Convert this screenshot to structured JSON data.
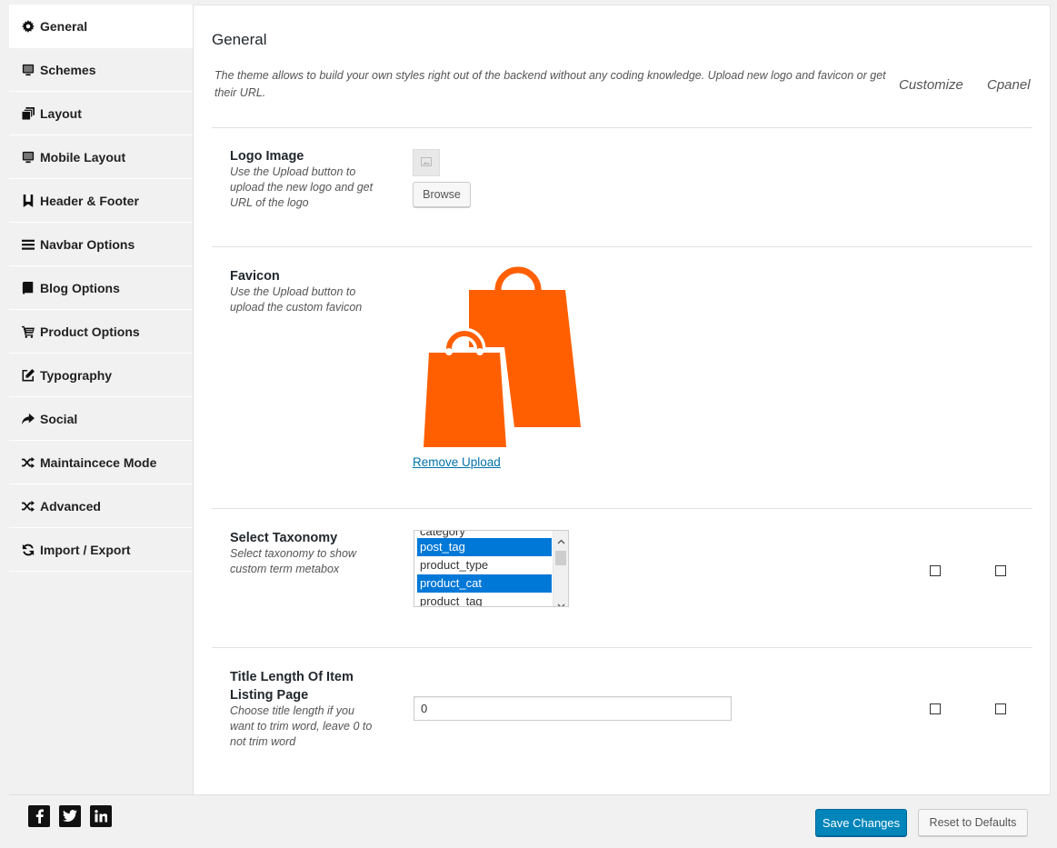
{
  "sidebar": {
    "items": [
      {
        "label": "General",
        "icon": "gear-icon",
        "active": true
      },
      {
        "label": "Schemes",
        "icon": "monitor-icon"
      },
      {
        "label": "Layout",
        "icon": "layers-icon"
      },
      {
        "label": "Mobile Layout",
        "icon": "monitor-icon"
      },
      {
        "label": "Header & Footer",
        "icon": "bookmark-icon"
      },
      {
        "label": "Navbar Options",
        "icon": "menu-icon"
      },
      {
        "label": "Blog Options",
        "icon": "book-icon"
      },
      {
        "label": "Product Options",
        "icon": "cart-icon"
      },
      {
        "label": "Typography",
        "icon": "edit-icon"
      },
      {
        "label": "Social",
        "icon": "share-icon"
      },
      {
        "label": "Maintaincece Mode",
        "icon": "shuffle-icon"
      },
      {
        "label": "Advanced",
        "icon": "shuffle-icon"
      },
      {
        "label": "Import / Export",
        "icon": "refresh-icon"
      }
    ]
  },
  "header": {
    "title": "General",
    "intro": "The theme allows to build your own styles right out of the backend without any coding knowledge. Upload new logo and favicon or get their URL.",
    "links": [
      "Customize",
      "Cpanel"
    ]
  },
  "options": {
    "logo": {
      "title": "Logo Image",
      "desc": "Use the Upload button to upload the new logo and get URL of the logo",
      "browse_label": "Browse"
    },
    "favicon": {
      "title": "Favicon",
      "desc": "Use the Upload button to upload the custom favicon",
      "remove_label": "Remove Upload",
      "icon": "shopping-bags-icon"
    },
    "taxonomy": {
      "title": "Select Taxonomy",
      "desc": "Select taxonomy to show custom term metabox",
      "options": [
        {
          "label": "category",
          "selected": false
        },
        {
          "label": "post_tag",
          "selected": true
        },
        {
          "label": "product_type",
          "selected": false
        },
        {
          "label": "product_cat",
          "selected": true
        },
        {
          "label": "product_tag",
          "selected": false
        }
      ]
    },
    "title_length": {
      "title": "Title Length Of Item Listing Page",
      "desc": "Choose title length if you want to trim word, leave 0 to not trim word",
      "value": "0"
    }
  },
  "footer": {
    "social": [
      "facebook-icon",
      "twitter-icon",
      "linkedin-icon"
    ],
    "save_label": "Save Changes",
    "reset_label": "Reset to Defaults"
  },
  "colors": {
    "accent": "#0085ba",
    "favicon": "#ff5f00",
    "selection": "#0078d7"
  }
}
